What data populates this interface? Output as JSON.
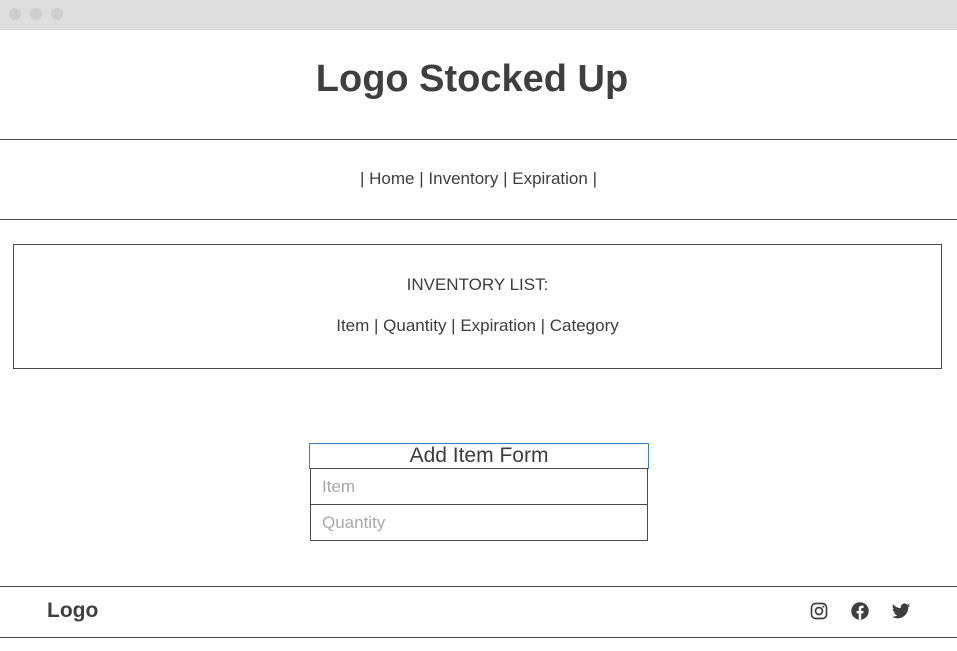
{
  "window": {
    "controls": [
      "close",
      "minimize",
      "maximize"
    ]
  },
  "header": {
    "title": "Logo Stocked Up"
  },
  "nav": {
    "sep": "|",
    "items": [
      {
        "label": "Home"
      },
      {
        "label": "Inventory"
      },
      {
        "label": "Expiration"
      }
    ]
  },
  "inventory": {
    "heading": "INVENTORY LIST:",
    "columns": "Item | Quantity | Expiration | Category"
  },
  "form": {
    "title": "Add Item Form",
    "item_placeholder": "Item",
    "quantity_placeholder": "Quantity"
  },
  "footer": {
    "logo": "Logo",
    "social_icons": [
      "instagram-icon",
      "facebook-icon",
      "twitter-icon"
    ]
  },
  "colors": {
    "text": "#3d3d3d",
    "titlebar": "#dedede",
    "focus_border": "#3b82c4",
    "placeholder": "#a8a8a8"
  }
}
